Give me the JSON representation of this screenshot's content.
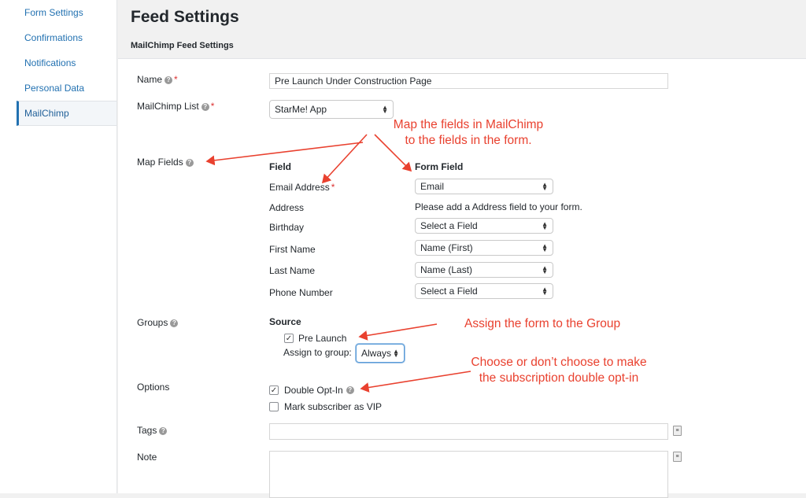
{
  "sidebar": {
    "items": [
      {
        "label": "Form Settings"
      },
      {
        "label": "Confirmations"
      },
      {
        "label": "Notifications"
      },
      {
        "label": "Personal Data"
      },
      {
        "label": "MailChimp"
      }
    ]
  },
  "header": {
    "title": "Feed Settings",
    "section": "MailChimp Feed Settings"
  },
  "form": {
    "name": {
      "label": "Name",
      "value": "Pre Launch Under Construction Page"
    },
    "list": {
      "label": "MailChimp List",
      "value": "StarMe! App"
    },
    "map_fields": {
      "label": "Map Fields",
      "col_field": "Field",
      "col_form_field": "Form Field",
      "rows": [
        {
          "field": "Email Address",
          "form_field": "Email",
          "type": "select",
          "required": true
        },
        {
          "field": "Address",
          "form_field": "Please add a Address field to your form.",
          "type": "text"
        },
        {
          "field": "Birthday",
          "form_field": "Select a Field",
          "type": "select"
        },
        {
          "field": "First Name",
          "form_field": "Name (First)",
          "type": "select"
        },
        {
          "field": "Last Name",
          "form_field": "Name (Last)",
          "type": "select"
        },
        {
          "field": "Phone Number",
          "form_field": "Select a Field",
          "type": "select"
        }
      ]
    },
    "groups": {
      "label": "Groups",
      "source": "Source",
      "group_name": "Pre Launch",
      "group_checked": true,
      "assign_label": "Assign to group:",
      "assign_value": "Always"
    },
    "options": {
      "label": "Options",
      "double_optin": "Double Opt-In",
      "double_optin_checked": true,
      "vip": "Mark subscriber as VIP",
      "vip_checked": false
    },
    "tags": {
      "label": "Tags",
      "value": ""
    },
    "note": {
      "label": "Note",
      "value": ""
    }
  },
  "annotations": {
    "map": [
      "Map the fields in MailChimp",
      "to the fields in the form."
    ],
    "group": "Assign the form to the Group",
    "optin": [
      "Choose or don’t choose to make",
      "the subscription double opt-in"
    ]
  },
  "colors": {
    "accent": "#2271b1",
    "annotation": "#e9412f",
    "required": "#dc3232"
  }
}
